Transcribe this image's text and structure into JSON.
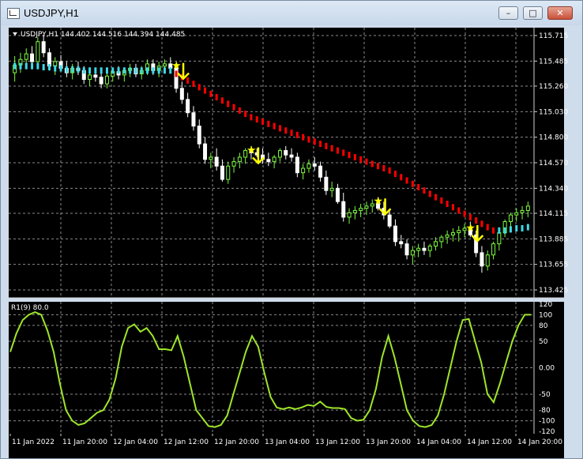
{
  "window": {
    "title": "USDJPY,H1",
    "icon": "chart-window-icon",
    "buttons": {
      "minimize": "minimize-icon",
      "maximize": "maximize-icon",
      "close": "close-icon"
    }
  },
  "main_panel": {
    "header": "USDJPY,H1  144.402 144.516 144.394 144.485",
    "price_levels": [
      "115.715",
      "115.485",
      "115.260",
      "115.030",
      "114.800",
      "114.570",
      "114.340",
      "114.115",
      "113.885",
      "113.655",
      "113.425"
    ]
  },
  "sub_panel": {
    "header": "R1(9) 80.0",
    "levels": [
      "120",
      "100",
      "80",
      "50",
      "0.00",
      "-50",
      "-80",
      "-100",
      "-120"
    ]
  },
  "time_labels": [
    "11 Jan 2022",
    "11 Jan 20:00",
    "12 Jan 04:00",
    "12 Jan 12:00",
    "12 Jan 20:00",
    "13 Jan 04:00",
    "13 Jan 12:00",
    "13 Jan 20:00",
    "14 Jan 04:00",
    "14 Jan 12:00",
    "14 Jan 20:00"
  ],
  "colors": {
    "background": "#000000",
    "grid": "#8a8a8a",
    "bull_candle": "#7cfc3c",
    "bear_candle": "#ffffff",
    "trend_down": "#ff0000",
    "trend_up": "#3fd7e6",
    "signal": "#ffff00",
    "oscillator": "#9ee52a"
  },
  "chart_data": [
    {
      "type": "candlestick",
      "symbol": "USDJPY",
      "timeframe": "H1",
      "ohlc": [
        [
          115.38,
          115.53,
          115.3,
          115.45
        ],
        [
          115.45,
          115.56,
          115.38,
          115.5
        ],
        [
          115.5,
          115.6,
          115.42,
          115.55
        ],
        [
          115.55,
          115.62,
          115.45,
          115.48
        ],
        [
          115.48,
          115.7,
          115.44,
          115.66
        ],
        [
          115.66,
          115.72,
          115.52,
          115.56
        ],
        [
          115.56,
          115.6,
          115.4,
          115.44
        ],
        [
          115.44,
          115.52,
          115.36,
          115.48
        ],
        [
          115.48,
          115.54,
          115.4,
          115.42
        ],
        [
          115.42,
          115.48,
          115.34,
          115.38
        ],
        [
          115.38,
          115.46,
          115.32,
          115.42
        ],
        [
          115.42,
          115.48,
          115.36,
          115.4
        ],
        [
          115.4,
          115.44,
          115.28,
          115.32
        ],
        [
          115.32,
          115.4,
          115.26,
          115.36
        ],
        [
          115.36,
          115.42,
          115.3,
          115.34
        ],
        [
          115.34,
          115.4,
          115.24,
          115.28
        ],
        [
          115.28,
          115.38,
          115.24,
          115.35
        ],
        [
          115.35,
          115.42,
          115.3,
          115.39
        ],
        [
          115.39,
          115.44,
          115.32,
          115.36
        ],
        [
          115.36,
          115.42,
          115.3,
          115.4
        ],
        [
          115.4,
          115.46,
          115.34,
          115.42
        ],
        [
          115.42,
          115.46,
          115.34,
          115.37
        ],
        [
          115.37,
          115.44,
          115.32,
          115.4
        ],
        [
          115.4,
          115.5,
          115.36,
          115.46
        ],
        [
          115.46,
          115.5,
          115.36,
          115.4
        ],
        [
          115.4,
          115.48,
          115.34,
          115.44
        ],
        [
          115.44,
          115.5,
          115.4,
          115.46
        ],
        [
          115.46,
          115.52,
          115.38,
          115.42
        ],
        [
          115.42,
          115.46,
          115.2,
          115.24
        ],
        [
          115.24,
          115.3,
          115.1,
          115.14
        ],
        [
          115.14,
          115.2,
          114.98,
          115.02
        ],
        [
          115.02,
          115.08,
          114.86,
          114.9
        ],
        [
          114.9,
          114.96,
          114.7,
          114.74
        ],
        [
          114.74,
          114.8,
          114.56,
          114.6
        ],
        [
          114.6,
          114.66,
          114.52,
          114.62
        ],
        [
          114.62,
          114.7,
          114.5,
          114.54
        ],
        [
          114.54,
          114.6,
          114.4,
          114.42
        ],
        [
          114.42,
          114.58,
          114.38,
          114.54
        ],
        [
          114.54,
          114.62,
          114.48,
          114.58
        ],
        [
          114.58,
          114.66,
          114.52,
          114.62
        ],
        [
          114.62,
          114.7,
          114.56,
          114.68
        ],
        [
          114.68,
          114.72,
          114.6,
          114.66
        ],
        [
          114.66,
          114.7,
          114.62,
          114.64
        ],
        [
          114.64,
          114.7,
          114.56,
          114.6
        ],
        [
          114.6,
          114.66,
          114.54,
          114.58
        ],
        [
          114.58,
          114.64,
          114.52,
          114.62
        ],
        [
          114.62,
          114.7,
          114.58,
          114.68
        ],
        [
          114.68,
          114.72,
          114.6,
          114.64
        ],
        [
          114.64,
          114.7,
          114.58,
          114.62
        ],
        [
          114.62,
          114.66,
          114.44,
          114.48
        ],
        [
          114.48,
          114.56,
          114.42,
          114.52
        ],
        [
          114.52,
          114.6,
          114.48,
          114.56
        ],
        [
          114.56,
          114.62,
          114.5,
          114.54
        ],
        [
          114.54,
          114.58,
          114.4,
          114.44
        ],
        [
          114.44,
          114.5,
          114.28,
          114.32
        ],
        [
          114.32,
          114.4,
          114.26,
          114.34
        ],
        [
          114.34,
          114.38,
          114.2,
          114.22
        ],
        [
          114.22,
          114.3,
          114.04,
          114.08
        ],
        [
          114.08,
          114.16,
          114.02,
          114.12
        ],
        [
          114.12,
          114.18,
          114.06,
          114.14
        ],
        [
          114.14,
          114.2,
          114.08,
          114.16
        ],
        [
          114.16,
          114.22,
          114.1,
          114.18
        ],
        [
          114.18,
          114.24,
          114.12,
          114.2
        ],
        [
          114.2,
          114.26,
          114.14,
          114.16
        ],
        [
          114.16,
          114.22,
          114.06,
          114.1
        ],
        [
          114.1,
          114.14,
          113.98,
          114.0
        ],
        [
          114.0,
          114.06,
          113.82,
          113.86
        ],
        [
          113.86,
          113.92,
          113.8,
          113.84
        ],
        [
          113.84,
          113.88,
          113.7,
          113.74
        ],
        [
          113.74,
          113.82,
          113.66,
          113.78
        ],
        [
          113.78,
          113.84,
          113.72,
          113.8
        ],
        [
          113.8,
          113.86,
          113.74,
          113.78
        ],
        [
          113.78,
          113.84,
          113.72,
          113.82
        ],
        [
          113.82,
          113.9,
          113.78,
          113.86
        ],
        [
          113.86,
          113.92,
          113.8,
          113.9
        ],
        [
          113.9,
          113.96,
          113.84,
          113.92
        ],
        [
          113.92,
          113.98,
          113.86,
          113.94
        ],
        [
          113.94,
          114.0,
          113.86,
          113.96
        ],
        [
          113.96,
          114.02,
          113.9,
          113.98
        ],
        [
          113.98,
          114.04,
          113.9,
          113.92
        ],
        [
          113.92,
          113.96,
          113.72,
          113.76
        ],
        [
          113.76,
          113.82,
          113.58,
          113.64
        ],
        [
          113.64,
          113.78,
          113.6,
          113.74
        ],
        [
          113.74,
          113.86,
          113.7,
          113.84
        ],
        [
          113.84,
          113.96,
          113.78,
          113.94
        ],
        [
          113.94,
          114.06,
          113.9,
          114.04
        ],
        [
          114.04,
          114.12,
          113.98,
          114.1
        ],
        [
          114.1,
          114.16,
          114.04,
          114.12
        ],
        [
          114.12,
          114.18,
          114.06,
          114.14
        ],
        [
          114.14,
          114.22,
          114.08,
          114.18
        ]
      ],
      "trend_line": [
        115.44,
        115.44,
        115.44,
        115.44,
        115.44,
        115.43,
        115.43,
        115.42,
        115.42,
        115.41,
        115.41,
        115.41,
        115.4,
        115.4,
        115.4,
        115.4,
        115.4,
        115.4,
        115.4,
        115.4,
        115.4,
        115.4,
        115.4,
        115.4,
        115.4,
        115.4,
        115.4,
        115.4,
        115.37,
        115.34,
        115.31,
        115.28,
        115.25,
        115.22,
        115.19,
        115.16,
        115.13,
        115.1,
        115.07,
        115.04,
        115.01,
        114.98,
        114.96,
        114.94,
        114.92,
        114.9,
        114.88,
        114.86,
        114.84,
        114.82,
        114.8,
        114.78,
        114.76,
        114.74,
        114.72,
        114.7,
        114.68,
        114.66,
        114.64,
        114.62,
        114.6,
        114.58,
        114.56,
        114.54,
        114.52,
        114.5,
        114.47,
        114.44,
        114.41,
        114.38,
        114.35,
        114.32,
        114.29,
        114.26,
        114.23,
        114.2,
        114.17,
        114.14,
        114.11,
        114.08,
        114.05,
        114.02,
        113.99,
        113.96,
        113.96,
        113.96,
        113.97,
        113.98,
        113.98,
        113.99
      ],
      "trend_direction_changes": [
        {
          "index": 28,
          "to": "down"
        },
        {
          "index": 84,
          "to": "up"
        }
      ],
      "signals": [
        {
          "index": 28,
          "price": 115.44,
          "type": "sell"
        },
        {
          "index": 41,
          "price": 114.68,
          "type": "sell"
        },
        {
          "index": 63,
          "price": 114.22,
          "type": "sell"
        },
        {
          "index": 79,
          "price": 113.98,
          "type": "sell"
        }
      ],
      "ylim": [
        113.425,
        115.715
      ]
    },
    {
      "type": "line",
      "name": "R1(9)",
      "values": [
        30,
        65,
        90,
        100,
        105,
        100,
        70,
        30,
        -30,
        -80,
        -100,
        -108,
        -105,
        -95,
        -85,
        -80,
        -60,
        -20,
        40,
        75,
        82,
        68,
        75,
        60,
        35,
        35,
        33,
        60,
        20,
        -30,
        -80,
        -95,
        -110,
        -112,
        -108,
        -90,
        -50,
        -10,
        30,
        60,
        40,
        -10,
        -55,
        -75,
        -78,
        -75,
        -78,
        -75,
        -70,
        -72,
        -64,
        -74,
        -76,
        -76,
        -78,
        -95,
        -100,
        -98,
        -80,
        -40,
        20,
        60,
        20,
        -30,
        -80,
        -100,
        -110,
        -112,
        -108,
        -90,
        -50,
        0,
        50,
        90,
        92,
        50,
        10,
        -50,
        -65,
        -30,
        10,
        50,
        80,
        100,
        100
      ],
      "ylim": [
        -120,
        120
      ]
    }
  ]
}
